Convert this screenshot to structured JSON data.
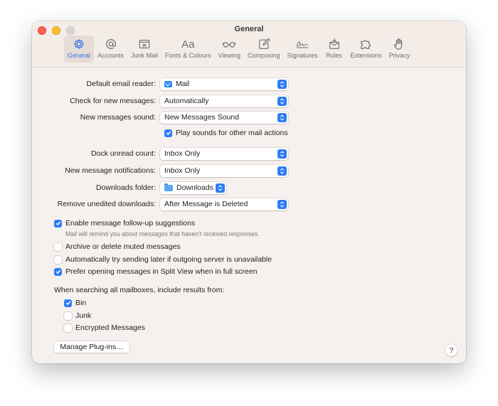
{
  "window": {
    "title": "General"
  },
  "toolbar": {
    "items": [
      {
        "label": "General",
        "icon": "gear-icon",
        "active": true
      },
      {
        "label": "Accounts",
        "icon": "at-icon"
      },
      {
        "label": "Junk Mail",
        "icon": "junk-tray-icon"
      },
      {
        "label": "Fonts & Colours",
        "icon": "aa-icon",
        "glyph": "Aa"
      },
      {
        "label": "Viewing",
        "icon": "glasses-icon"
      },
      {
        "label": "Composing",
        "icon": "compose-icon"
      },
      {
        "label": "Signatures",
        "icon": "signature-icon"
      },
      {
        "label": "Rules",
        "icon": "rules-envelope-icon"
      },
      {
        "label": "Extensions",
        "icon": "puzzle-icon"
      },
      {
        "label": "Privacy",
        "icon": "hand-icon"
      }
    ]
  },
  "settings": {
    "default_reader": {
      "label": "Default email reader:",
      "value": "Mail"
    },
    "check_messages": {
      "label": "Check for new messages:",
      "value": "Automatically"
    },
    "new_sound": {
      "label": "New messages sound:",
      "value": "New Messages Sound"
    },
    "play_sounds": {
      "label": "Play sounds for other mail actions",
      "checked": true
    },
    "dock_unread": {
      "label": "Dock unread count:",
      "value": "Inbox Only"
    },
    "notifications": {
      "label": "New message notifications:",
      "value": "Inbox Only"
    },
    "downloads_folder": {
      "label": "Downloads folder:",
      "value": "Downloads"
    },
    "remove_downloads": {
      "label": "Remove unedited downloads:",
      "value": "After Message is Deleted"
    }
  },
  "options": {
    "follow_up": {
      "label": "Enable message follow-up suggestions",
      "checked": true,
      "sub": "Mail will remind you about messages that haven't received responses."
    },
    "archive_muted": {
      "label": "Archive or delete muted messages",
      "checked": false
    },
    "send_later": {
      "label": "Automatically try sending later if outgoing server is unavailable",
      "checked": false
    },
    "split_view": {
      "label": "Prefer opening messages in Split View when in full screen",
      "checked": true
    }
  },
  "search": {
    "heading": "When searching all mailboxes, include results from:",
    "bin": {
      "label": "Bin",
      "checked": true
    },
    "junk": {
      "label": "Junk",
      "checked": false
    },
    "encrypted": {
      "label": "Encrypted Messages",
      "checked": false
    }
  },
  "buttons": {
    "manage_plugins": "Manage Plug-ins…",
    "help": "?"
  },
  "colors": {
    "accent": "#2e7cf6",
    "window_bg": "#f6f1ee",
    "selected_tab": "#e5dcd7"
  }
}
